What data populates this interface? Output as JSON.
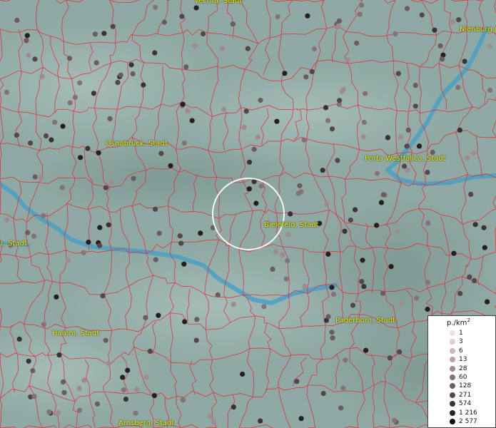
{
  "map": {
    "city_labels": [
      {
        "name": "Vechta, Stadt"
      },
      {
        "name": "Nienburg (Weser)"
      },
      {
        "name": "Osnabrück, Stadt"
      },
      {
        "name": "Porta Westfalica, Stadt"
      },
      {
        "name": "Bielefeld, Stadt"
      },
      {
        "name": "Münster, Stadt"
      },
      {
        "name": "Paderborn, Stadt"
      },
      {
        "name": "Hamm, Stadt"
      },
      {
        "name": "Arnsberg, Stadt"
      }
    ],
    "colors": {
      "terrain": "#8fa9a4",
      "borders": "#e0303a",
      "rivers": "#3f9fc8",
      "labels": "#f4f000",
      "highlight_circle": "#ffffff"
    }
  },
  "legend": {
    "title": "p./km",
    "title_sup": "2",
    "items": [
      {
        "label": "1",
        "color": "#efe2e4"
      },
      {
        "label": "3",
        "color": "#e0cdd0"
      },
      {
        "label": "6",
        "color": "#cdb8bc"
      },
      {
        "label": "13",
        "color": "#b7a2a7"
      },
      {
        "label": "28",
        "color": "#9f8a8f"
      },
      {
        "label": "60",
        "color": "#857278"
      },
      {
        "label": "128",
        "color": "#6c5b61"
      },
      {
        "label": "271",
        "color": "#54464b"
      },
      {
        "label": "574",
        "color": "#3c3236"
      },
      {
        "label": "1 216",
        "color": "#261f22"
      },
      {
        "label": "2 577",
        "color": "#0f0c0d"
      }
    ]
  }
}
